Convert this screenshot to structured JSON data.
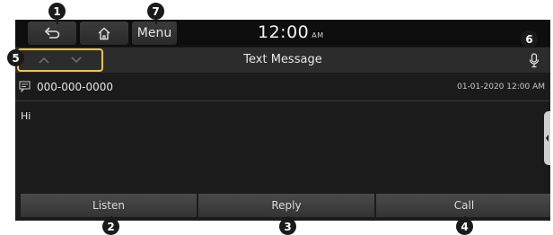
{
  "status_bar": {
    "menu_label": "Menu",
    "time": "12:00",
    "time_suffix": "AM"
  },
  "title_bar": {
    "title": "Text Message"
  },
  "message": {
    "sender_number": "000-000-0000",
    "timestamp": "01-01-2020 12:00 AM",
    "body": "Hi"
  },
  "buttons": {
    "listen": "Listen",
    "reply": "Reply",
    "call": "Call"
  },
  "callouts": [
    "1",
    "2",
    "3",
    "4",
    "5",
    "6",
    "7"
  ],
  "icons": {
    "back": "back-icon",
    "home": "home-icon",
    "prev": "chevron-up-icon",
    "next": "chevron-down-icon",
    "mic": "microphone-icon",
    "sender": "message-icon"
  },
  "colors": {
    "screen_bg": "#1b1b1b",
    "highlight": "#f0c44c",
    "callout": "#1a1a1a"
  }
}
